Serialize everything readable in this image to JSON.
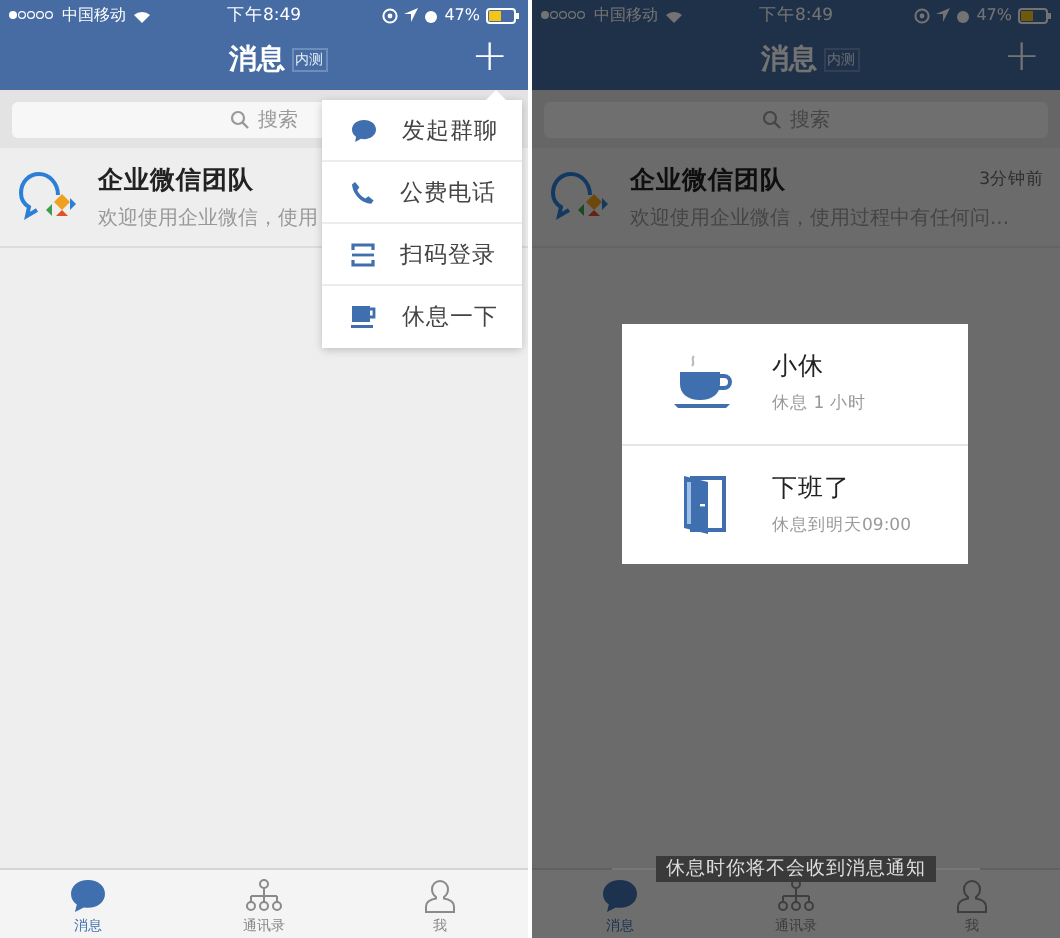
{
  "screens": [
    {
      "dimmed": false,
      "status_bar": {
        "carrier": "中国移动",
        "time": "下午8:49",
        "battery": "47%"
      },
      "nav": {
        "title": "消息",
        "badge": "内测",
        "action": "+"
      },
      "search": {
        "placeholder": "搜索"
      },
      "conversations": [
        {
          "name": "企业微信团队",
          "preview": "欢迎使用企业微信，使用"
        }
      ],
      "menu": {
        "items": [
          {
            "label": "发起群聊",
            "kind": "chat"
          },
          {
            "label": "公费电话",
            "kind": "phone"
          },
          {
            "label": "扫码登录",
            "kind": "scan"
          },
          {
            "label": "休息一下",
            "kind": "cup"
          }
        ]
      },
      "tabs": [
        {
          "label": "消息",
          "kind": "chat",
          "selected": true
        },
        {
          "label": "通讯录",
          "kind": "org",
          "selected": false
        },
        {
          "label": "我",
          "kind": "person",
          "selected": false
        }
      ]
    },
    {
      "dimmed": true,
      "status_bar": {
        "carrier": "中国移动",
        "time": "下午8:49",
        "battery": "47%"
      },
      "nav": {
        "title": "消息",
        "badge": "内测",
        "action": "+"
      },
      "search": {
        "placeholder": "搜索"
      },
      "conversations": [
        {
          "name": "企业微信团队",
          "preview": "欢迎使用企业微信，使用过程中有任何问...",
          "time": "3分钟前"
        }
      ],
      "dialog": {
        "options": [
          {
            "title": "小休",
            "subtitle": "休息 1 小时",
            "kind": "cup"
          },
          {
            "title": "下班了",
            "subtitle": "休息到明天09:00",
            "kind": "door"
          }
        ]
      },
      "hint": "休息时你将不会收到消息通知",
      "tabs": [
        {
          "label": "消息",
          "kind": "chat",
          "selected": true
        },
        {
          "label": "通讯录",
          "kind": "org",
          "selected": false
        },
        {
          "label": "我",
          "kind": "person",
          "selected": false
        }
      ]
    }
  ]
}
